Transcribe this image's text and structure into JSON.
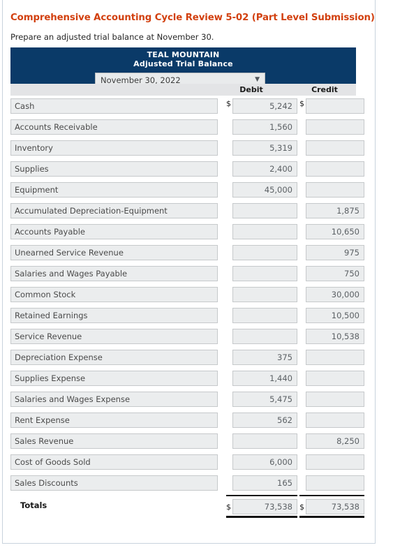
{
  "assignment": {
    "title": "Comprehensive Accounting Cycle Review 5-02 (Part Level Submission)",
    "title_color": "#d2400f",
    "instruction": "Prepare an adjusted trial balance at November 30."
  },
  "statement": {
    "company_name": "TEAL MOUNTAIN",
    "statement_name": "Adjusted Trial Balance",
    "banner_color": "#0a3a68",
    "period_select": {
      "value": "November 30, 2022",
      "arrow_icon": "chevron-down-icon"
    },
    "columns": {
      "account": "",
      "debit": "Debit",
      "credit": "Credit"
    },
    "currency_symbol": "$",
    "rows": [
      {
        "account": "Cash",
        "debit": "5,242",
        "credit": ""
      },
      {
        "account": "Accounts Receivable",
        "debit": "1,560",
        "credit": ""
      },
      {
        "account": "Inventory",
        "debit": "5,319",
        "credit": ""
      },
      {
        "account": "Supplies",
        "debit": "2,400",
        "credit": ""
      },
      {
        "account": "Equipment",
        "debit": "45,000",
        "credit": ""
      },
      {
        "account": "Accumulated Depreciation-Equipment",
        "debit": "",
        "credit": "1,875"
      },
      {
        "account": "Accounts Payable",
        "debit": "",
        "credit": "10,650"
      },
      {
        "account": "Unearned Service Revenue",
        "debit": "",
        "credit": "975"
      },
      {
        "account": "Salaries and Wages Payable",
        "debit": "",
        "credit": "750"
      },
      {
        "account": "Common Stock",
        "debit": "",
        "credit": "30,000"
      },
      {
        "account": "Retained Earnings",
        "debit": "",
        "credit": "10,500"
      },
      {
        "account": "Service Revenue",
        "debit": "",
        "credit": "10,538"
      },
      {
        "account": "Depreciation Expense",
        "debit": "375",
        "credit": ""
      },
      {
        "account": "Supplies Expense",
        "debit": "1,440",
        "credit": ""
      },
      {
        "account": "Salaries and Wages Expense",
        "debit": "5,475",
        "credit": ""
      },
      {
        "account": "Rent Expense",
        "debit": "562",
        "credit": ""
      },
      {
        "account": "Sales Revenue",
        "debit": "",
        "credit": "8,250"
      },
      {
        "account": "Cost of Goods Sold",
        "debit": "6,000",
        "credit": ""
      },
      {
        "account": "Sales Discounts",
        "debit": "165",
        "credit": ""
      }
    ],
    "totals": {
      "label": "Totals",
      "debit": "73,538",
      "credit": "73,538"
    }
  }
}
